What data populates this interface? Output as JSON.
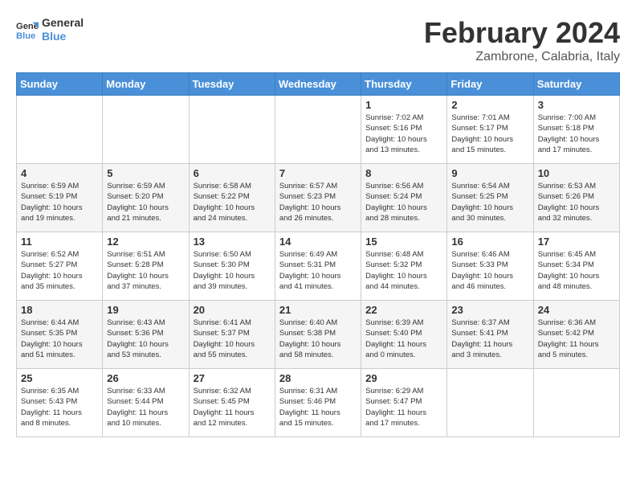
{
  "header": {
    "logo_line1": "General",
    "logo_line2": "Blue",
    "month_title": "February 2024",
    "subtitle": "Zambrone, Calabria, Italy"
  },
  "days_of_week": [
    "Sunday",
    "Monday",
    "Tuesday",
    "Wednesday",
    "Thursday",
    "Friday",
    "Saturday"
  ],
  "weeks": [
    [
      {
        "day": "",
        "info": ""
      },
      {
        "day": "",
        "info": ""
      },
      {
        "day": "",
        "info": ""
      },
      {
        "day": "",
        "info": ""
      },
      {
        "day": "1",
        "info": "Sunrise: 7:02 AM\nSunset: 5:16 PM\nDaylight: 10 hours\nand 13 minutes."
      },
      {
        "day": "2",
        "info": "Sunrise: 7:01 AM\nSunset: 5:17 PM\nDaylight: 10 hours\nand 15 minutes."
      },
      {
        "day": "3",
        "info": "Sunrise: 7:00 AM\nSunset: 5:18 PM\nDaylight: 10 hours\nand 17 minutes."
      }
    ],
    [
      {
        "day": "4",
        "info": "Sunrise: 6:59 AM\nSunset: 5:19 PM\nDaylight: 10 hours\nand 19 minutes."
      },
      {
        "day": "5",
        "info": "Sunrise: 6:59 AM\nSunset: 5:20 PM\nDaylight: 10 hours\nand 21 minutes."
      },
      {
        "day": "6",
        "info": "Sunrise: 6:58 AM\nSunset: 5:22 PM\nDaylight: 10 hours\nand 24 minutes."
      },
      {
        "day": "7",
        "info": "Sunrise: 6:57 AM\nSunset: 5:23 PM\nDaylight: 10 hours\nand 26 minutes."
      },
      {
        "day": "8",
        "info": "Sunrise: 6:56 AM\nSunset: 5:24 PM\nDaylight: 10 hours\nand 28 minutes."
      },
      {
        "day": "9",
        "info": "Sunrise: 6:54 AM\nSunset: 5:25 PM\nDaylight: 10 hours\nand 30 minutes."
      },
      {
        "day": "10",
        "info": "Sunrise: 6:53 AM\nSunset: 5:26 PM\nDaylight: 10 hours\nand 32 minutes."
      }
    ],
    [
      {
        "day": "11",
        "info": "Sunrise: 6:52 AM\nSunset: 5:27 PM\nDaylight: 10 hours\nand 35 minutes."
      },
      {
        "day": "12",
        "info": "Sunrise: 6:51 AM\nSunset: 5:28 PM\nDaylight: 10 hours\nand 37 minutes."
      },
      {
        "day": "13",
        "info": "Sunrise: 6:50 AM\nSunset: 5:30 PM\nDaylight: 10 hours\nand 39 minutes."
      },
      {
        "day": "14",
        "info": "Sunrise: 6:49 AM\nSunset: 5:31 PM\nDaylight: 10 hours\nand 41 minutes."
      },
      {
        "day": "15",
        "info": "Sunrise: 6:48 AM\nSunset: 5:32 PM\nDaylight: 10 hours\nand 44 minutes."
      },
      {
        "day": "16",
        "info": "Sunrise: 6:46 AM\nSunset: 5:33 PM\nDaylight: 10 hours\nand 46 minutes."
      },
      {
        "day": "17",
        "info": "Sunrise: 6:45 AM\nSunset: 5:34 PM\nDaylight: 10 hours\nand 48 minutes."
      }
    ],
    [
      {
        "day": "18",
        "info": "Sunrise: 6:44 AM\nSunset: 5:35 PM\nDaylight: 10 hours\nand 51 minutes."
      },
      {
        "day": "19",
        "info": "Sunrise: 6:43 AM\nSunset: 5:36 PM\nDaylight: 10 hours\nand 53 minutes."
      },
      {
        "day": "20",
        "info": "Sunrise: 6:41 AM\nSunset: 5:37 PM\nDaylight: 10 hours\nand 55 minutes."
      },
      {
        "day": "21",
        "info": "Sunrise: 6:40 AM\nSunset: 5:38 PM\nDaylight: 10 hours\nand 58 minutes."
      },
      {
        "day": "22",
        "info": "Sunrise: 6:39 AM\nSunset: 5:40 PM\nDaylight: 11 hours\nand 0 minutes."
      },
      {
        "day": "23",
        "info": "Sunrise: 6:37 AM\nSunset: 5:41 PM\nDaylight: 11 hours\nand 3 minutes."
      },
      {
        "day": "24",
        "info": "Sunrise: 6:36 AM\nSunset: 5:42 PM\nDaylight: 11 hours\nand 5 minutes."
      }
    ],
    [
      {
        "day": "25",
        "info": "Sunrise: 6:35 AM\nSunset: 5:43 PM\nDaylight: 11 hours\nand 8 minutes."
      },
      {
        "day": "26",
        "info": "Sunrise: 6:33 AM\nSunset: 5:44 PM\nDaylight: 11 hours\nand 10 minutes."
      },
      {
        "day": "27",
        "info": "Sunrise: 6:32 AM\nSunset: 5:45 PM\nDaylight: 11 hours\nand 12 minutes."
      },
      {
        "day": "28",
        "info": "Sunrise: 6:31 AM\nSunset: 5:46 PM\nDaylight: 11 hours\nand 15 minutes."
      },
      {
        "day": "29",
        "info": "Sunrise: 6:29 AM\nSunset: 5:47 PM\nDaylight: 11 hours\nand 17 minutes."
      },
      {
        "day": "",
        "info": ""
      },
      {
        "day": "",
        "info": ""
      }
    ]
  ]
}
